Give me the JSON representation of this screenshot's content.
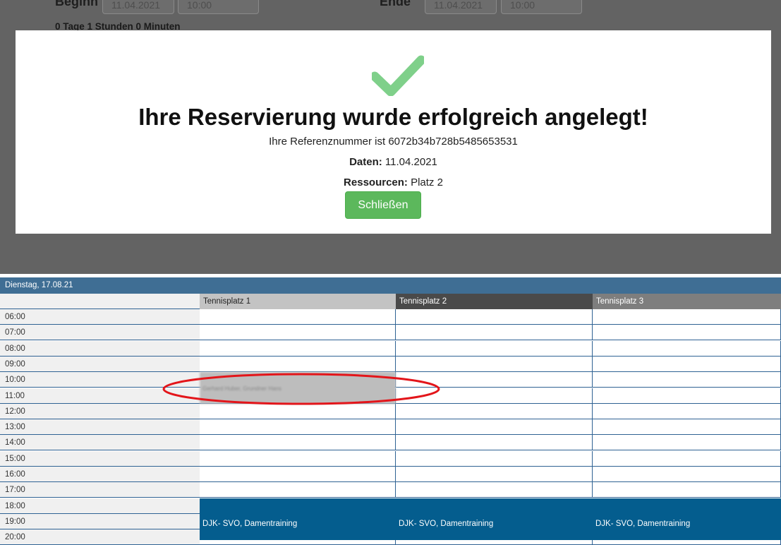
{
  "form": {
    "begin_label": "Beginn",
    "begin_date": "11.04.2021",
    "begin_time": "10:00",
    "end_label": "Ende",
    "end_date": "11.04.2021",
    "end_time": "10:00",
    "duration": "0 Tage 1 Stunden 0 Minuten"
  },
  "modal": {
    "title": "Ihre Reservierung wurde erfolgreich angelegt!",
    "reference": "Ihre Referenznummer ist 6072b34b728b5485653531",
    "date_label": "Daten:",
    "date_value": " 11.04.2021",
    "resource_label": "Ressourcen:",
    "resource_value": " Platz 2",
    "close_button": "Schließen",
    "check_color": "#7fd08a",
    "button_color": "#5cb85c"
  },
  "calendar": {
    "day": "Dienstag, 17.08.21",
    "courts": [
      "Tennisplatz 1",
      "Tennisplatz 2",
      "Tennisplatz 3"
    ],
    "times": [
      "06:00",
      "07:00",
      "08:00",
      "09:00",
      "10:00",
      "11:00",
      "12:00",
      "13:00",
      "14:00",
      "15:00",
      "16:00",
      "17:00",
      "18:00",
      "19:00",
      "20:00"
    ],
    "booking": "Gerhard Huber, Grundner Hans",
    "training": "DJK- SVO, Damentraining",
    "colors": {
      "header": "#3f6e94",
      "training": "#045d8e",
      "booking": "#bdbdbd",
      "annotation": "#e3151a"
    }
  }
}
